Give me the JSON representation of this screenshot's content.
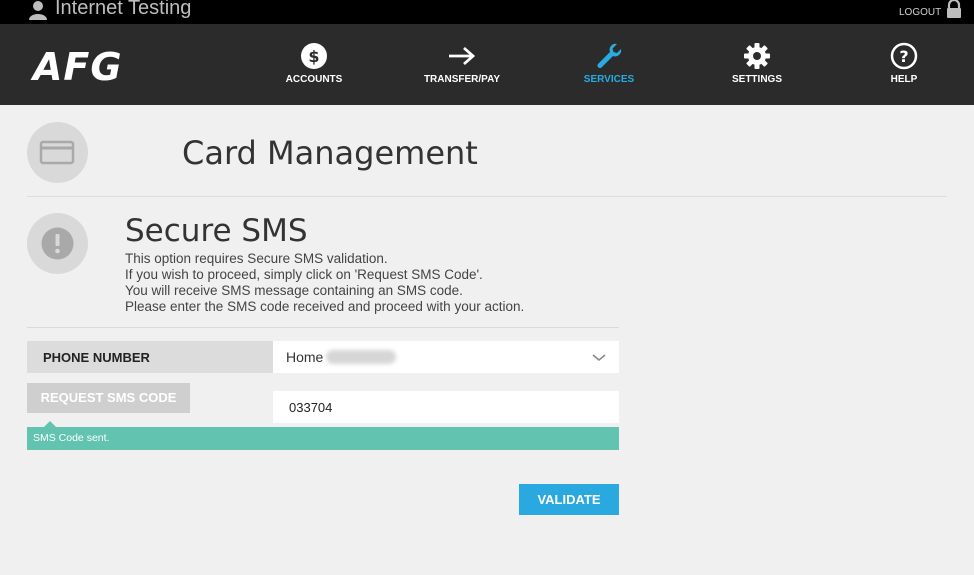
{
  "topbar": {
    "user_name": "Internet Testing",
    "logout_label": "LOGOUT"
  },
  "header": {
    "logo_text": "AFG",
    "nav": [
      {
        "label": "ACCOUNTS",
        "icon": "dollar-icon",
        "active": false
      },
      {
        "label": "TRANSFER/PAY",
        "icon": "arrow-right-icon",
        "active": false
      },
      {
        "label": "SERVICES",
        "icon": "wrench-icon",
        "active": true
      },
      {
        "label": "SETTINGS",
        "icon": "gear-icon",
        "active": false
      },
      {
        "label": "HELP",
        "icon": "question-icon",
        "active": false
      }
    ],
    "active_color": "#29abe2"
  },
  "page": {
    "title": "Card Management"
  },
  "secure_sms": {
    "title": "Secure SMS",
    "description": [
      "This option requires Secure SMS validation.",
      "If you wish to proceed, simply click on 'Request SMS Code'.",
      "You will receive SMS message containing an SMS code.",
      "Please enter the SMS code received and proceed with your action."
    ]
  },
  "form": {
    "phone_label": "PHONE NUMBER",
    "phone_selected": "Home",
    "request_button": "REQUEST SMS CODE",
    "sms_code_value": "033704",
    "status_message": "SMS Code sent.",
    "validate_button": "VALIDATE"
  },
  "colors": {
    "nav_bg": "#2b2b2b",
    "status_bg": "#61c3b0",
    "validate_bg": "#29a9e0"
  }
}
